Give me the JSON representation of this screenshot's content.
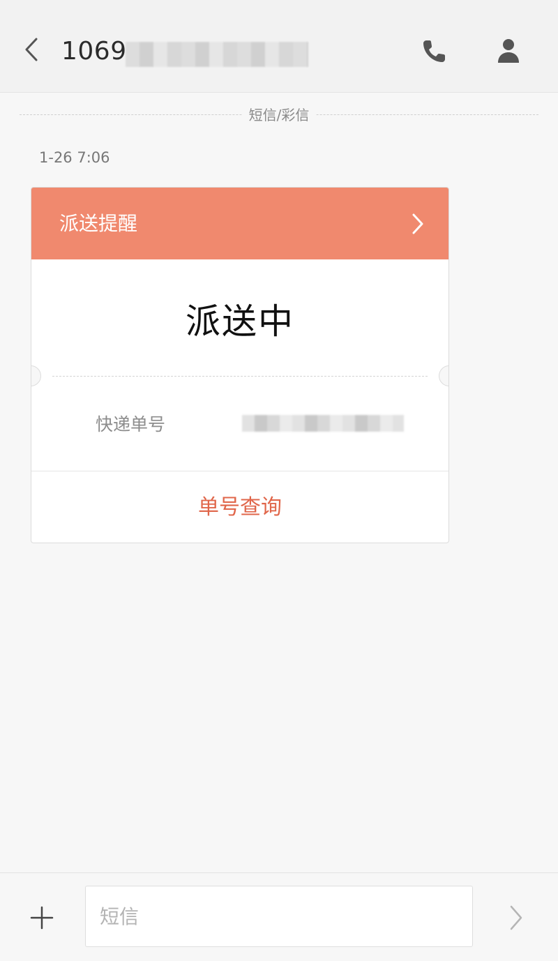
{
  "header": {
    "title": "1069",
    "icons": {
      "back": "chevron-left-icon",
      "call": "phone-icon",
      "contact": "person-icon"
    }
  },
  "conversation": {
    "type_label": "短信/彩信",
    "timestamp": "1-26 7:06"
  },
  "card": {
    "header_title": "派送提醒",
    "header_color": "#f0896e",
    "status": "派送中",
    "tracking_label": "快递单号",
    "query_label": "单号查询",
    "accent_color": "#e0664a"
  },
  "composer": {
    "placeholder": "短信",
    "icons": {
      "attach": "plus-icon",
      "send": "chevron-right-icon"
    }
  }
}
